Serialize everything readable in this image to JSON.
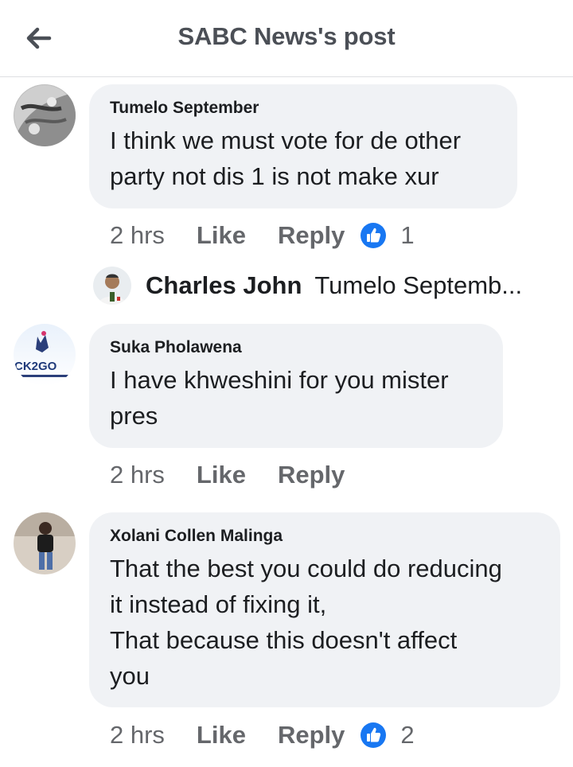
{
  "header": {
    "title": "SABC News's post"
  },
  "comments": [
    {
      "author": "Tumelo September",
      "text": "I think we must vote for de other\nparty not dis 1 is not make xur",
      "time": "2 hrs",
      "like_label": "Like",
      "reply_label": "Reply",
      "reaction_count": "1",
      "reply_preview": {
        "author": "Charles John",
        "text": "Tumelo Septemb..."
      }
    },
    {
      "author": "Suka Pholawena",
      "text": "I have khweshini for you mister\npres",
      "time": "2 hrs",
      "like_label": "Like",
      "reply_label": "Reply",
      "avatar_text": "CK2GO"
    },
    {
      "author": "Xolani Collen Malinga",
      "text": "That the best you could do reducing\nit instead of fixing it,\nThat because this doesn't affect\nyou",
      "time": "2 hrs",
      "like_label": "Like",
      "reply_label": "Reply",
      "reaction_count": "2"
    }
  ],
  "colors": {
    "like_blue": "#1877f2",
    "bubble": "#f0f2f5",
    "muted": "#65676b"
  }
}
